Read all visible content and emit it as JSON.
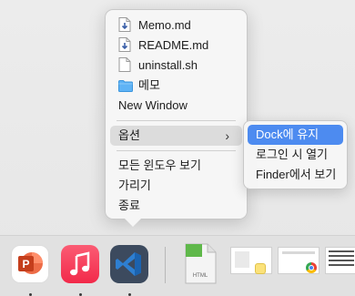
{
  "context_menu": {
    "files": [
      {
        "label": "Memo.md",
        "icon": "markdown-file-icon"
      },
      {
        "label": "README.md",
        "icon": "markdown-file-icon"
      },
      {
        "label": "uninstall.sh",
        "icon": "document-icon"
      },
      {
        "label": "메모",
        "icon": "folder-icon"
      }
    ],
    "new_window": "New Window",
    "options": "옵션",
    "show_all_windows": "모든 윈도우 보기",
    "hide": "가리기",
    "quit": "종료"
  },
  "options_submenu": {
    "keep_in_dock": "Dock에 유지",
    "open_at_login": "로그인 시 열기",
    "show_in_finder": "Finder에서 보기"
  },
  "dock": {
    "apps": [
      {
        "name": "PowerPoint",
        "icon": "powerpoint-icon",
        "color": "#d24726"
      },
      {
        "name": "Music",
        "icon": "music-note-icon",
        "color": "#f5425c"
      },
      {
        "name": "Visual Studio Code",
        "icon": "vscode-icon",
        "color": "#3c4a5e"
      }
    ],
    "html_file_label": "HTML"
  },
  "colors": {
    "selection": "#4d8bf0",
    "folder": "#5fb3f5"
  }
}
